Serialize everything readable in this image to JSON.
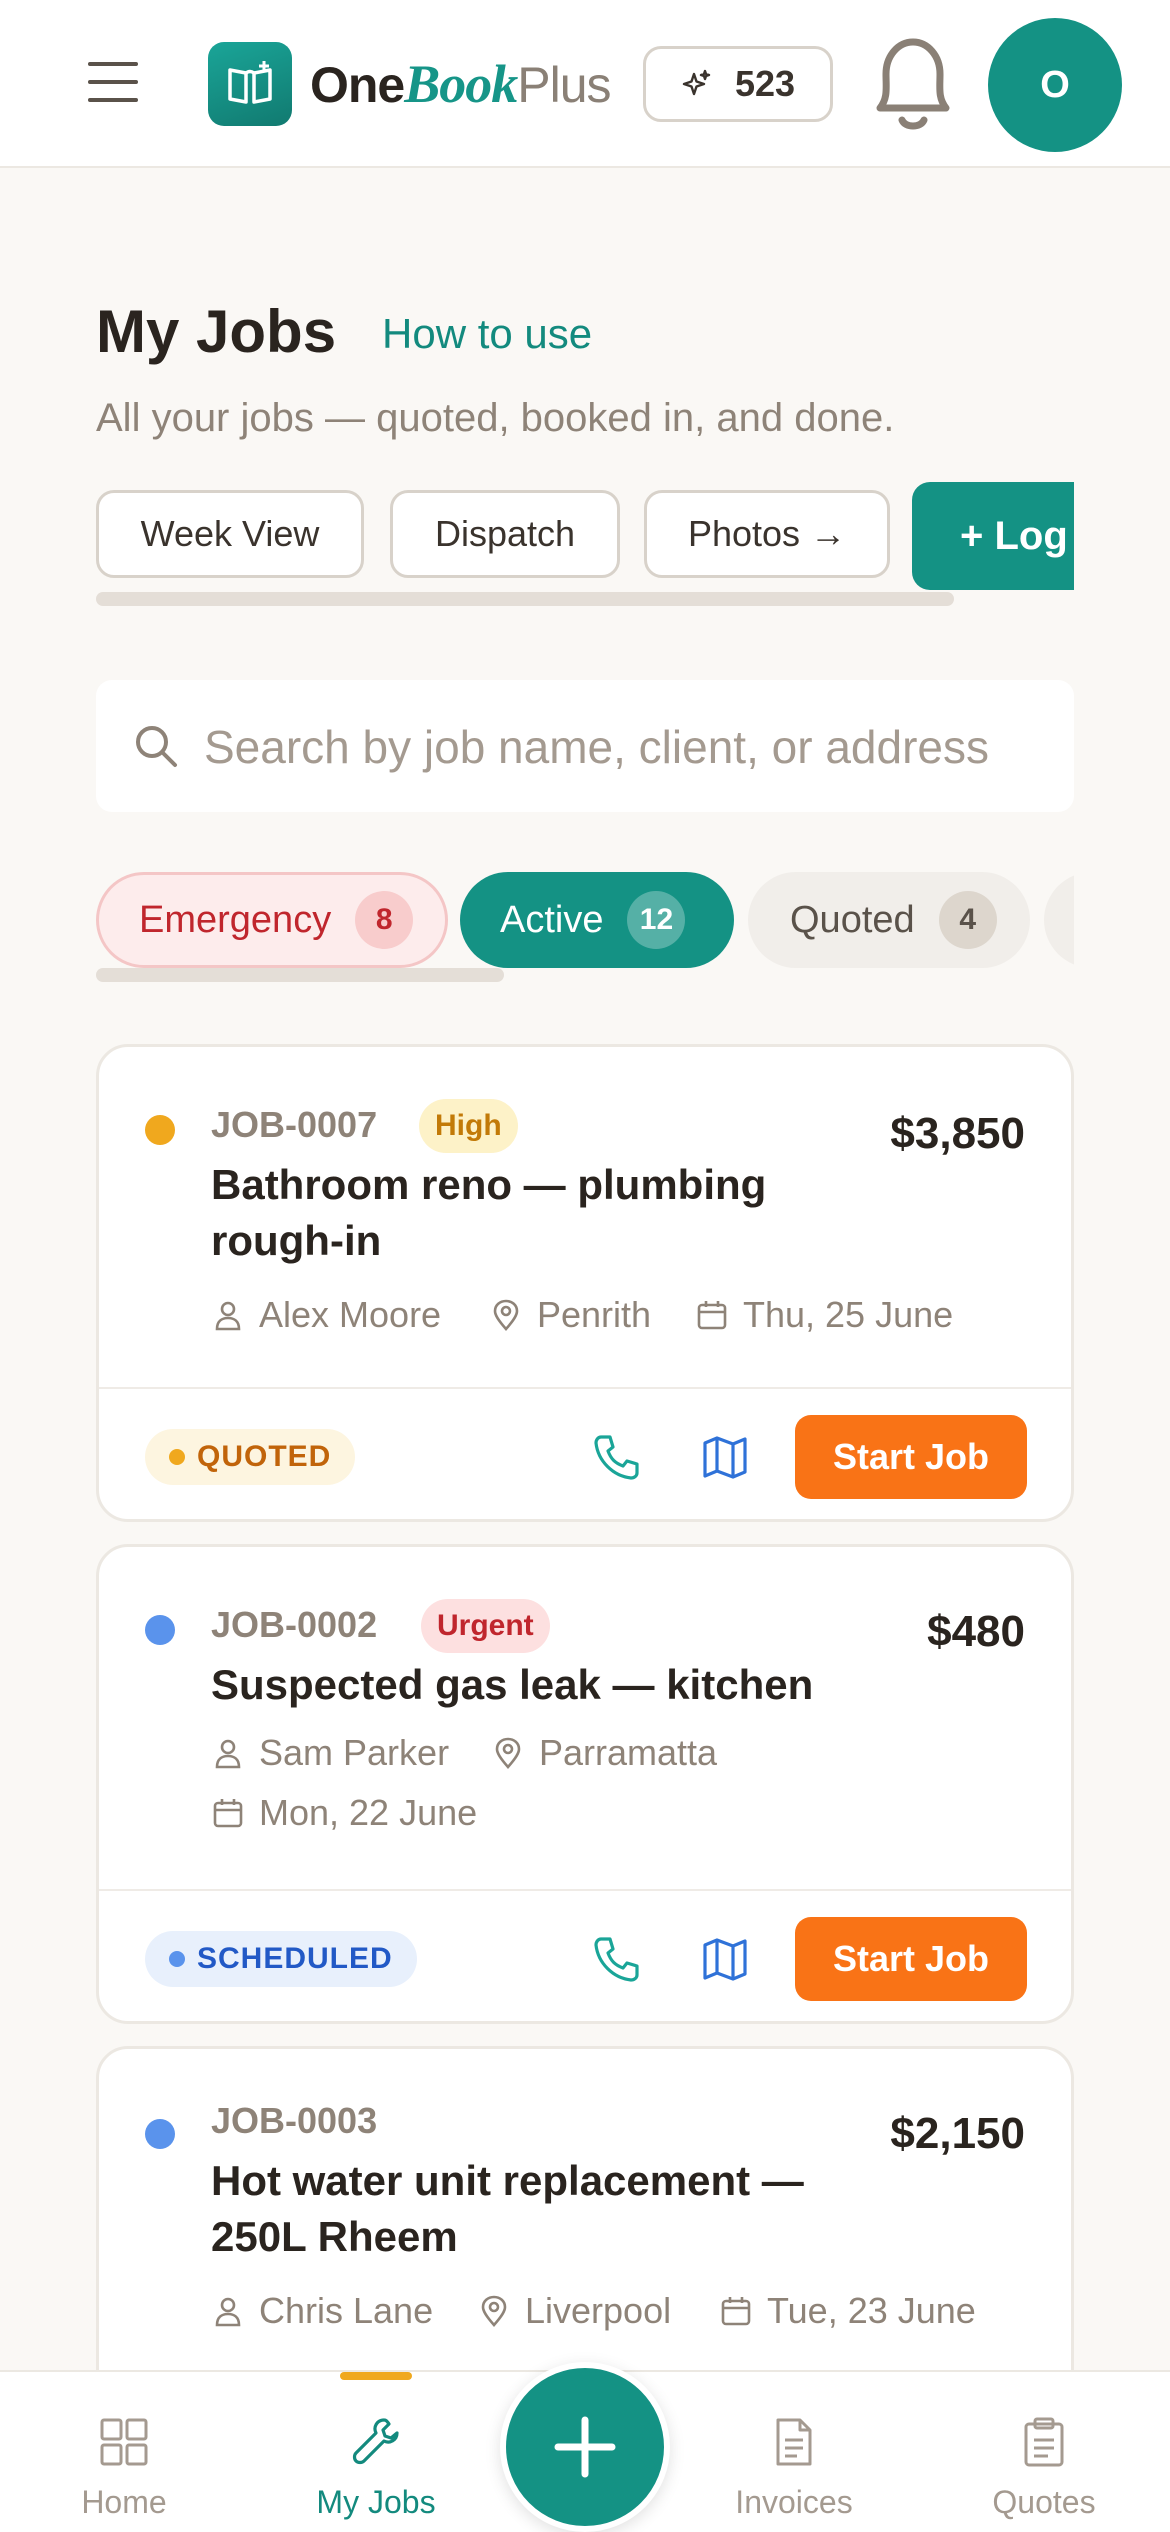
{
  "header": {
    "brand_one": "One",
    "brand_book": "Book",
    "brand_plus": "Plus",
    "credits": "523",
    "avatar_initial": "O"
  },
  "page": {
    "title": "My Jobs",
    "how_to": "How to use",
    "subtitle": "All your jobs — quoted, booked in, and done."
  },
  "quick_actions": [
    {
      "label": "Week View"
    },
    {
      "label": "Dispatch"
    },
    {
      "label": "Photos →"
    },
    {
      "label": "+ Log"
    }
  ],
  "search": {
    "placeholder": "Search by job name, client, or address"
  },
  "filters": [
    {
      "label": "Emergency",
      "count": "8"
    },
    {
      "label": "Active",
      "count": "12"
    },
    {
      "label": "Quoted",
      "count": "4"
    }
  ],
  "jobs": [
    {
      "id": "JOB-0007",
      "priority": "High",
      "price": "$3,850",
      "title": "Bathroom reno — plumbing rough-in",
      "client": "Alex Moore",
      "location": "Penrith",
      "date": "Thu, 25 June",
      "status": "QUOTED",
      "action": "Start Job",
      "dot_color": "#f0a81e"
    },
    {
      "id": "JOB-0002",
      "priority": "Urgent",
      "price": "$480",
      "title": "Suspected gas leak — kitchen",
      "client": "Sam Parker",
      "location": "Parramatta",
      "date": "Mon, 22 June",
      "status": "SCHEDULED",
      "action": "Start Job",
      "dot_color": "#5a93ec"
    },
    {
      "id": "JOB-0003",
      "price": "$2,150",
      "title": "Hot water unit replacement — 250L Rheem",
      "client": "Chris Lane",
      "location": "Liverpool",
      "date": "Tue, 23 June",
      "dot_color": "#5a93ec"
    }
  ],
  "bottom_nav": [
    {
      "label": "Home"
    },
    {
      "label": "My Jobs"
    },
    {
      "label": "Invoices"
    },
    {
      "label": "Quotes"
    }
  ],
  "colors": {
    "brand": "#149284",
    "action": "#f97316",
    "background": "#faf8f5"
  }
}
